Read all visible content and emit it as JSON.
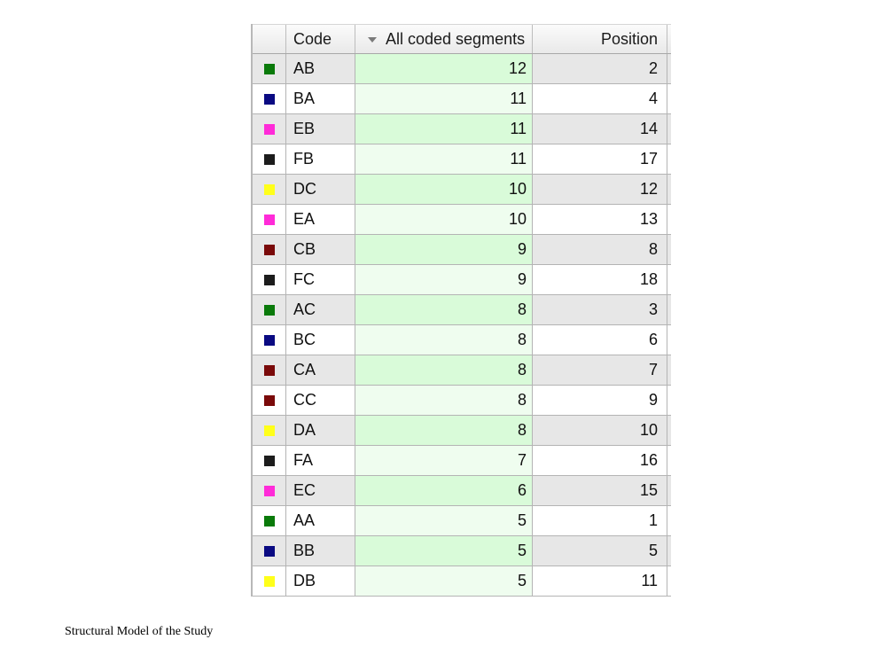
{
  "table": {
    "columns": {
      "code": "Code",
      "segments": "All coded segments",
      "position": "Position"
    },
    "rows": [
      {
        "code": "AB",
        "color": "#0a7a0a",
        "segments": "12",
        "position": "2"
      },
      {
        "code": "BA",
        "color": "#0a0a82",
        "segments": "11",
        "position": "4"
      },
      {
        "code": "EB",
        "color": "#ff2bd8",
        "segments": "11",
        "position": "14"
      },
      {
        "code": "FB",
        "color": "#1c1c1c",
        "segments": "11",
        "position": "17"
      },
      {
        "code": "DC",
        "color": "#ffff1a",
        "segments": "10",
        "position": "12"
      },
      {
        "code": "EA",
        "color": "#ff2bd8",
        "segments": "10",
        "position": "13"
      },
      {
        "code": "CB",
        "color": "#7a0a0a",
        "segments": "9",
        "position": "8"
      },
      {
        "code": "FC",
        "color": "#1c1c1c",
        "segments": "9",
        "position": "18"
      },
      {
        "code": "AC",
        "color": "#0a7a0a",
        "segments": "8",
        "position": "3"
      },
      {
        "code": "BC",
        "color": "#0a0a82",
        "segments": "8",
        "position": "6"
      },
      {
        "code": "CA",
        "color": "#7a0a0a",
        "segments": "8",
        "position": "7"
      },
      {
        "code": "CC",
        "color": "#7a0a0a",
        "segments": "8",
        "position": "9"
      },
      {
        "code": "DA",
        "color": "#ffff1a",
        "segments": "8",
        "position": "10"
      },
      {
        "code": "FA",
        "color": "#1c1c1c",
        "segments": "7",
        "position": "16"
      },
      {
        "code": "EC",
        "color": "#ff2bd8",
        "segments": "6",
        "position": "15"
      },
      {
        "code": "AA",
        "color": "#0a7a0a",
        "segments": "5",
        "position": "1"
      },
      {
        "code": "BB",
        "color": "#0a0a82",
        "segments": "5",
        "position": "5"
      },
      {
        "code": "DB",
        "color": "#ffff1a",
        "segments": "5",
        "position": "11"
      }
    ]
  },
  "caption": "Structural Model of the Study"
}
